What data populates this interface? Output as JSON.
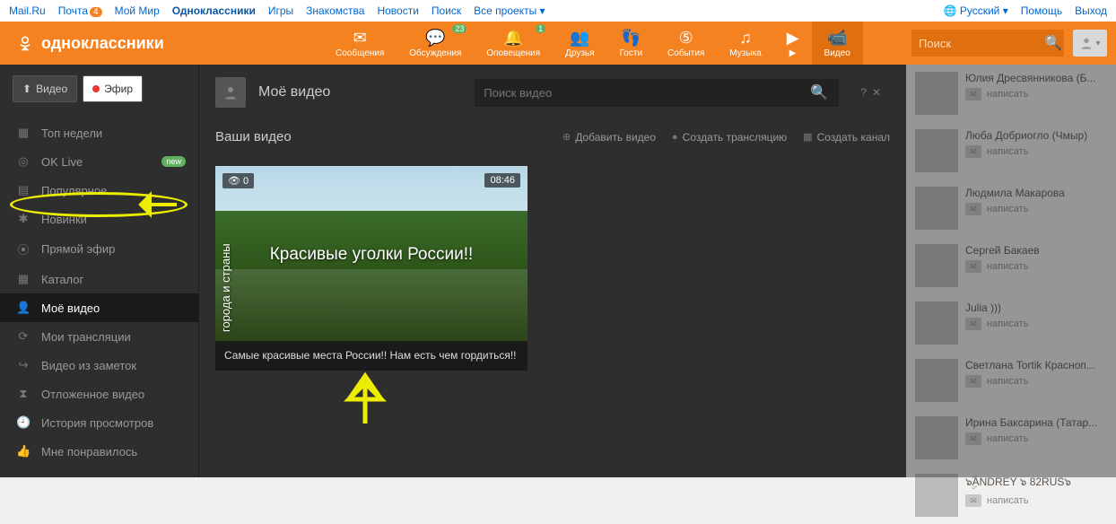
{
  "topbar": {
    "left": [
      "Mail.Ru",
      "Почта",
      "Мой Мир",
      "Одноклассники",
      "Игры",
      "Знакомства",
      "Новости",
      "Поиск",
      "Все проекты"
    ],
    "mail_badge": "4",
    "right_lang": "Русский",
    "right": [
      "Помощь",
      "Выход"
    ]
  },
  "logo": "одноклассники",
  "nav": [
    {
      "label": "Сообщения",
      "icon": "✉"
    },
    {
      "label": "Обсуждения",
      "icon": "💬",
      "badge": "23"
    },
    {
      "label": "Оповещения",
      "icon": "🔔",
      "badge": "1"
    },
    {
      "label": "Друзья",
      "icon": "👥"
    },
    {
      "label": "Гости",
      "icon": "👣"
    },
    {
      "label": "События",
      "icon": "⑤"
    },
    {
      "label": "Музыка",
      "icon": "♫"
    },
    {
      "label": "▶",
      "icon": "▶"
    },
    {
      "label": "Видео",
      "icon": "📹",
      "active": true
    }
  ],
  "search_placeholder": "Поиск",
  "sidebar": {
    "upload": "Видео",
    "live": "Эфир",
    "menu": [
      {
        "label": "Топ недели",
        "icon": "▦"
      },
      {
        "label": "OK Live",
        "icon": "◎",
        "new": "new"
      },
      {
        "label": "Популярное",
        "icon": "▤"
      },
      {
        "label": "Новинки",
        "icon": "✱"
      },
      {
        "label": "Прямой эфир",
        "icon": "⦿"
      },
      {
        "label": "Каталог",
        "icon": "▦"
      },
      {
        "label": "Моё видео",
        "icon": "👤",
        "selected": true
      },
      {
        "label": "Мои трансляции",
        "icon": "⟳"
      },
      {
        "label": "Видео из заметок",
        "icon": "↪"
      },
      {
        "label": "Отложенное видео",
        "icon": "⧗"
      },
      {
        "label": "История просмотров",
        "icon": "🕘"
      },
      {
        "label": "Мне понравилось",
        "icon": "👍"
      }
    ]
  },
  "content": {
    "title": "Моё видео",
    "search_placeholder": "Поиск видео",
    "sub_title": "Ваши видео",
    "actions": [
      {
        "label": "Добавить видео",
        "icon": "⊕"
      },
      {
        "label": "Создать трансляцию",
        "icon": "●"
      },
      {
        "label": "Создать канал",
        "icon": "▦"
      }
    ],
    "video": {
      "views": "0",
      "duration": "08:46",
      "side_label": "города и страны",
      "overlay_title": "Красивые уголки России!!",
      "caption": "Самые красивые места России!! Нам есть чем гордиться!!"
    }
  },
  "friends": [
    {
      "name": "Юлия Дресвянникова (Б..."
    },
    {
      "name": "Люба Добриогло (Чмыр)"
    },
    {
      "name": "Людмила Макарова"
    },
    {
      "name": "Сергей Бакаев"
    },
    {
      "name": "Julia )))"
    },
    {
      "name": "Светлана Tortik Красноп..."
    },
    {
      "name": "Ирина Баксарина (Татар..."
    },
    {
      "name": "๖ۣۜANDREY ๖ 82RUS๖"
    }
  ],
  "friend_write": "написать"
}
